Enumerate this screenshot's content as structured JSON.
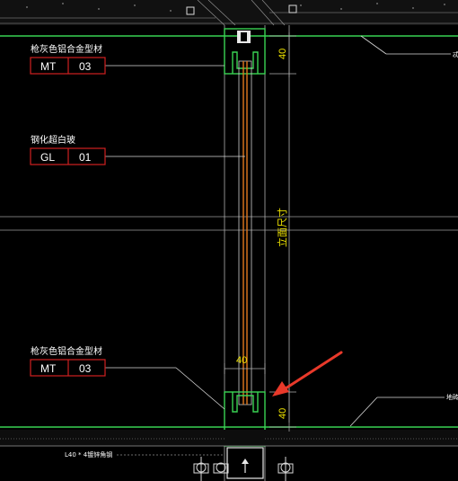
{
  "labels": {
    "top_material": "枪灰色铝合金型材",
    "glass": "钢化超白玻",
    "bottom_material": "枪灰色铝合金型材",
    "angle": "L40 * 4镀锌角钢",
    "elevation": "立面尺寸",
    "right_top": "忒",
    "right_bottom": "地砖"
  },
  "tags": {
    "mt_top": {
      "code": "MT",
      "num": "03"
    },
    "gl": {
      "code": "GL",
      "num": "01"
    },
    "mt_bottom": {
      "code": "MT",
      "num": "03"
    }
  },
  "dims": {
    "top": "40",
    "bottom_horizontal": "40",
    "bottom_vertical": "40"
  },
  "colors": {
    "background": "#000000",
    "profile": "#39d353",
    "glass": "#e0781e",
    "tag_border": "#d02020",
    "dimension": "#f2e600",
    "arrow": "#e8392a"
  }
}
